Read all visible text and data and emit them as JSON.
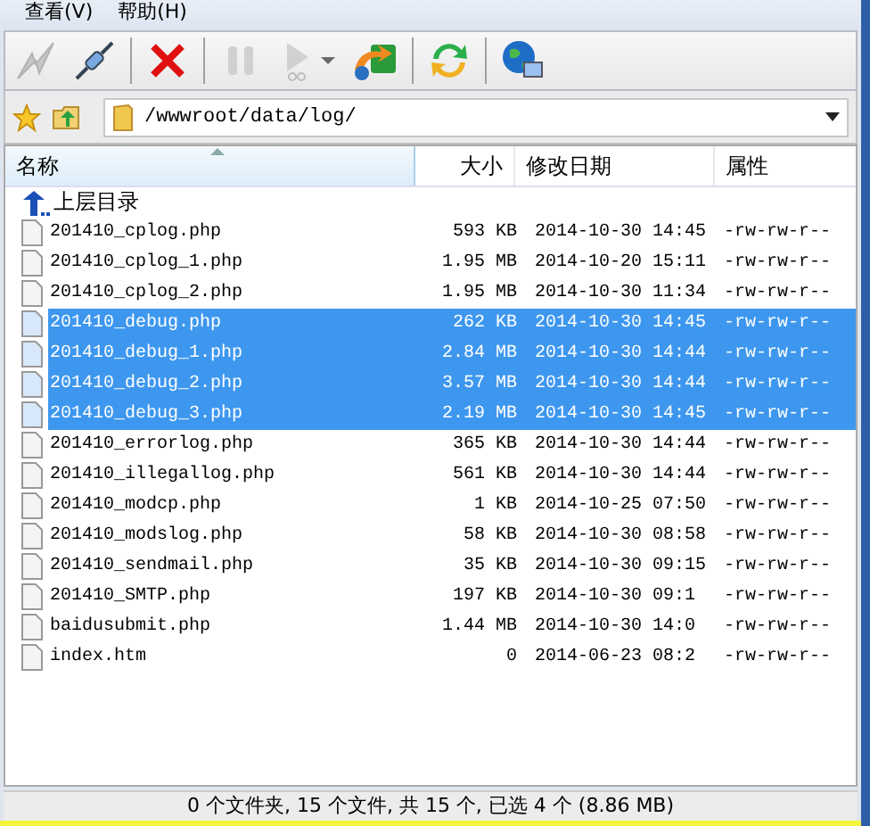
{
  "menu": [
    {
      "label": "查看(V)"
    },
    {
      "label": "帮助(H)"
    }
  ],
  "toolbar": [
    {
      "kind": "connect",
      "disabled": true
    },
    {
      "kind": "plug",
      "disabled": false
    },
    {
      "kind": "sep"
    },
    {
      "kind": "stop",
      "disabled": false
    },
    {
      "kind": "sep"
    },
    {
      "kind": "pause",
      "disabled": true
    },
    {
      "kind": "play",
      "disabled": true
    },
    {
      "kind": "transfer",
      "disabled": false
    },
    {
      "kind": "sep"
    },
    {
      "kind": "refresh",
      "disabled": false
    },
    {
      "kind": "sep"
    },
    {
      "kind": "globe",
      "disabled": false
    }
  ],
  "address": {
    "value": "/wwwroot/data/log/"
  },
  "columns": [
    {
      "label": "名称",
      "sorted": true
    },
    {
      "label": "大小",
      "sorted": false
    },
    {
      "label": "修改日期",
      "sorted": false
    },
    {
      "label": "属性",
      "sorted": false
    }
  ],
  "parent_row": {
    "label": "上层目录"
  },
  "files": [
    {
      "name": "201410_cplog.php",
      "size": "593 KB",
      "date": "2014-10-30 14:45",
      "attributes": "-rw-rw-r--",
      "selected": false
    },
    {
      "name": "201410_cplog_1.php",
      "size": "1.95 MB",
      "date": "2014-10-20 15:11",
      "attributes": "-rw-rw-r--",
      "selected": false
    },
    {
      "name": "201410_cplog_2.php",
      "size": "1.95 MB",
      "date": "2014-10-30 11:34",
      "attributes": "-rw-rw-r--",
      "selected": false
    },
    {
      "name": "201410_debug.php",
      "size": "262 KB",
      "date": "2014-10-30 14:45",
      "attributes": "-rw-rw-r--",
      "selected": true
    },
    {
      "name": "201410_debug_1.php",
      "size": "2.84 MB",
      "date": "2014-10-30 14:44",
      "attributes": "-rw-rw-r--",
      "selected": true
    },
    {
      "name": "201410_debug_2.php",
      "size": "3.57 MB",
      "date": "2014-10-30 14:44",
      "attributes": "-rw-rw-r--",
      "selected": true
    },
    {
      "name": "201410_debug_3.php",
      "size": "2.19 MB",
      "date": "2014-10-30 14:45",
      "attributes": "-rw-rw-r--",
      "selected": true
    },
    {
      "name": "201410_errorlog.php",
      "size": "365 KB",
      "date": "2014-10-30 14:44",
      "attributes": "-rw-rw-r--",
      "selected": false
    },
    {
      "name": "201410_illegallog.php",
      "size": "561 KB",
      "date": "2014-10-30 14:44",
      "attributes": "-rw-rw-r--",
      "selected": false
    },
    {
      "name": "201410_modcp.php",
      "size": "1 KB",
      "date": "2014-10-25 07:50",
      "attributes": "-rw-rw-r--",
      "selected": false
    },
    {
      "name": "201410_modslog.php",
      "size": "58 KB",
      "date": "2014-10-30 08:58",
      "attributes": "-rw-rw-r--",
      "selected": false
    },
    {
      "name": "201410_sendmail.php",
      "size": "35 KB",
      "date": "2014-10-30 09:15",
      "attributes": "-rw-rw-r--",
      "selected": false
    },
    {
      "name": "201410_SMTP.php",
      "size": "197 KB",
      "date": "2014-10-30 09:1",
      "attributes": "-rw-rw-r--",
      "selected": false
    },
    {
      "name": "baidusubmit.php",
      "size": "1.44 MB",
      "date": "2014-10-30 14:0",
      "attributes": "-rw-rw-r--",
      "selected": false
    },
    {
      "name": "index.htm",
      "size": "0",
      "date": "2014-06-23 08:2",
      "attributes": "-rw-rw-r--",
      "selected": false
    }
  ],
  "status_bar": "0 个文件夹, 15 个文件, 共 15 个, 已选 4 个 (8.86 MB)"
}
